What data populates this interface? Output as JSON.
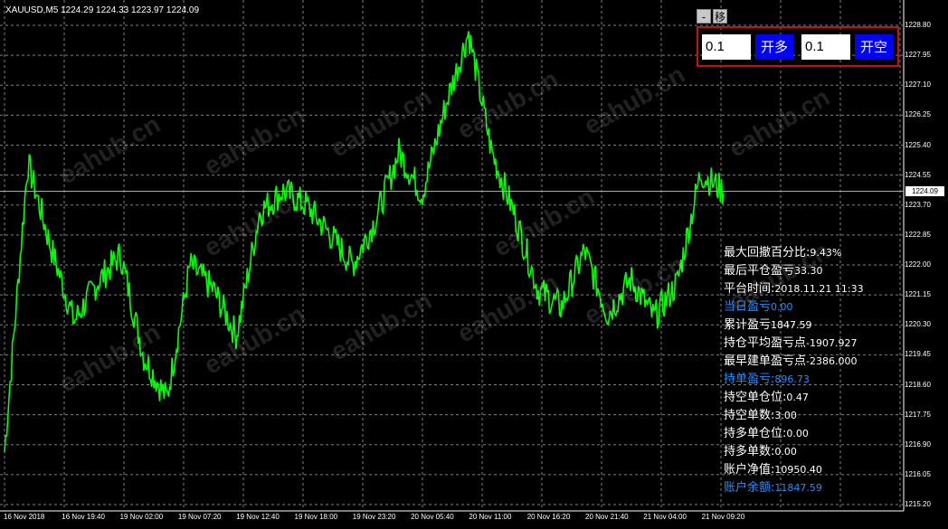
{
  "chart": {
    "symbol_line": "XAUUSD,M5  1224.29 1224.33 1223.97 1224.09",
    "current_price": "1224.09",
    "series_color": "#00ff00",
    "grid_color": "#808080",
    "price_axis": [
      "1228.80",
      "1227.95",
      "1227.10",
      "1226.25",
      "1225.40",
      "1224.55",
      "1223.70",
      "1222.85",
      "1222.00",
      "1221.15",
      "1220.30",
      "1219.45",
      "1218.60",
      "1217.75",
      "1216.90",
      "1216.05",
      "1215.20"
    ],
    "time_axis": [
      "16 Nov 2018",
      "16 Nov 19:40",
      "19 Nov 02:00",
      "19 Nov 07:20",
      "19 Nov 12:40",
      "19 Nov 18:00",
      "19 Nov 23:20",
      "20 Nov 05:40",
      "20 Nov 11:00",
      "20 Nov 16:20",
      "20 Nov 21:40",
      "21 Nov 04:00",
      "21 Nov 09:20"
    ],
    "watermark": "eahub.cn"
  },
  "chart_data": {
    "type": "line",
    "title": "XAUUSD,M5",
    "xlabel": "",
    "ylabel": "",
    "ylim": [
      1215.2,
      1228.8
    ],
    "x": [
      "16 Nov 2018",
      "16 Nov 19:40",
      "19 Nov 02:00",
      "19 Nov 07:20",
      "19 Nov 12:40",
      "19 Nov 18:00",
      "19 Nov 23:20",
      "20 Nov 05:40",
      "20 Nov 11:00",
      "20 Nov 16:20",
      "20 Nov 21:40",
      "21 Nov 04:00",
      "21 Nov 09:20"
    ],
    "series": [
      {
        "values": [
          1216.7,
          1224.9,
          1222.5,
          1220.4,
          1221.5,
          1222.3,
          1219.4,
          1218.2,
          1222.0,
          1221.3,
          1220.0,
          1223.5,
          1224.1,
          1223.7,
          1222.9,
          1222.0,
          1223.3,
          1225.2,
          1224.0,
          1226.5,
          1228.6,
          1225.2,
          1223.4,
          1221.3,
          1220.8,
          1222.4,
          1220.6,
          1221.6,
          1220.5,
          1221.5,
          1224.6,
          1224.09
        ]
      }
    ],
    "grid": true
  },
  "toolbar": {
    "minimize_label": "-",
    "move_label": "移"
  },
  "trade_panel": {
    "lot_long": "0.1",
    "open_long_label": "开多",
    "lot_short": "0.1",
    "open_short_label": "开空"
  },
  "stats": [
    {
      "label": "最大回撤百分比:",
      "value": "9.43%",
      "color": "white"
    },
    {
      "label": "最后平仓盈亏",
      "value": "33.30",
      "color": "white"
    },
    {
      "label": "平台时间:",
      "value": "2018.11.21 11:33",
      "color": "white"
    },
    {
      "label": "当日盈亏",
      "value": "0.00",
      "color": "blue"
    },
    {
      "label": "累计盈亏",
      "value": "1847.59",
      "color": "white"
    },
    {
      "label": "持仓平均盈亏点",
      "value": "-1907.927",
      "color": "white"
    },
    {
      "label": "最早建单盈亏点",
      "value": "-2386.000",
      "color": "white"
    },
    {
      "label": "持单盈亏:",
      "value": "896.73",
      "color": "blue"
    },
    {
      "label": "持空单仓位:",
      "value": "0.47",
      "color": "white"
    },
    {
      "label": "持空单数:",
      "value": "3.00",
      "color": "white"
    },
    {
      "label": "持多单仓位:",
      "value": "0.00",
      "color": "white"
    },
    {
      "label": "持多单数:",
      "value": "0.00",
      "color": "white"
    },
    {
      "label": "账户净值:",
      "value": "10950.40",
      "color": "white"
    },
    {
      "label": "账户余额:",
      "value": "11847.59",
      "color": "blue"
    }
  ]
}
